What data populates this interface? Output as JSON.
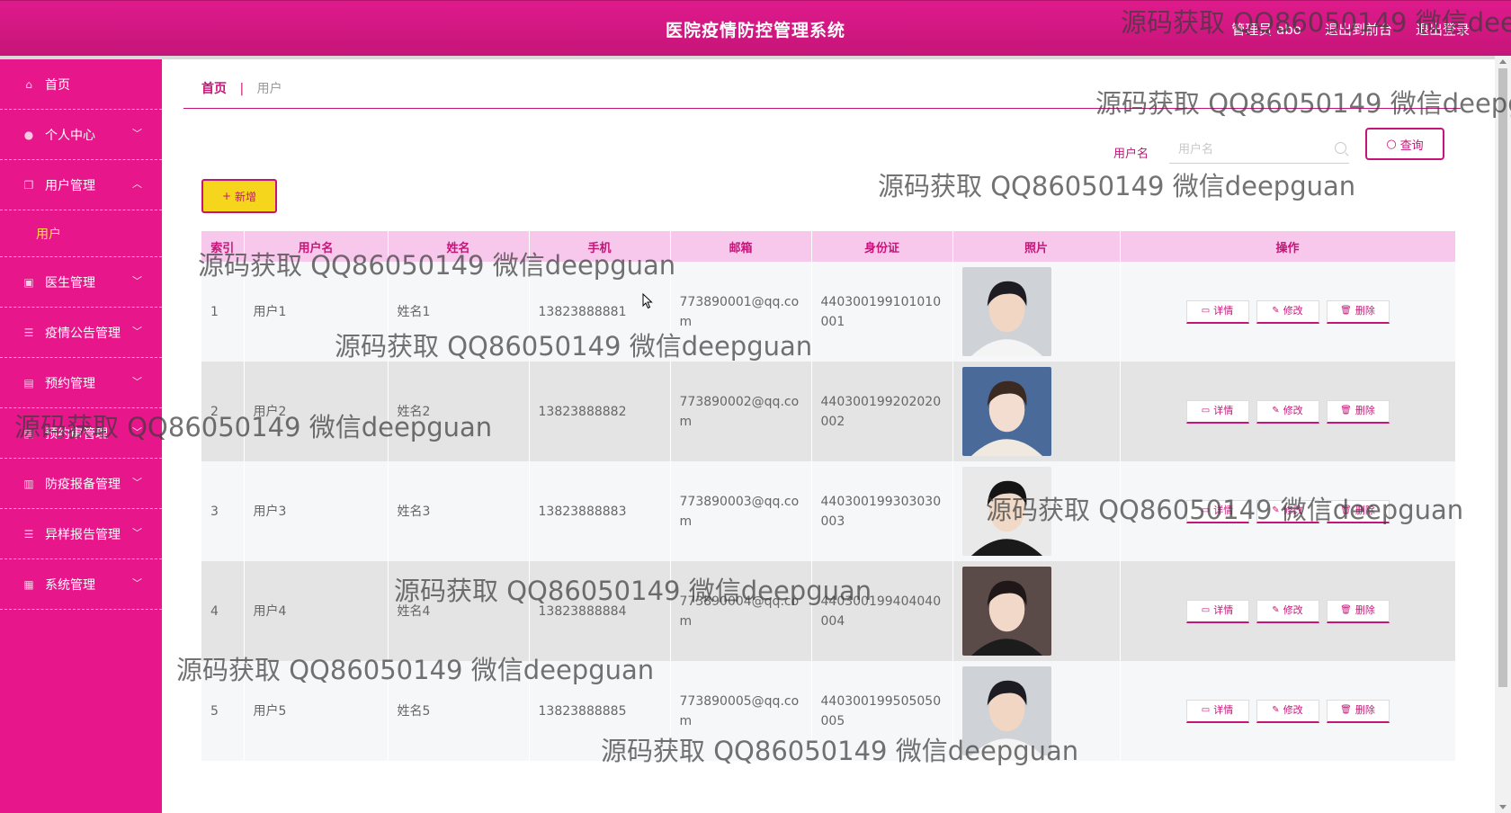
{
  "header": {
    "title": "医院疫情防控管理系统",
    "user": "管理员 abo",
    "to_front": "退出到前台",
    "logout": "退出登录"
  },
  "sidebar": {
    "items": [
      {
        "label": "首页",
        "icon": "home-icon",
        "chevron": ""
      },
      {
        "label": "个人中心",
        "icon": "user-icon",
        "chevron": "﹀"
      },
      {
        "label": "用户管理",
        "icon": "copy-icon",
        "chevron": "︿"
      },
      {
        "label": "医生管理",
        "icon": "chart-icon",
        "chevron": "﹀"
      },
      {
        "label": "疫情公告管理",
        "icon": "list-icon",
        "chevron": "﹀"
      },
      {
        "label": "预约管理",
        "icon": "clipboard-icon",
        "chevron": "﹀"
      },
      {
        "label": "预约审管理",
        "icon": "clipboard-icon",
        "chevron": "﹀"
      },
      {
        "label": "防疫报备管理",
        "icon": "report-icon",
        "chevron": "﹀"
      },
      {
        "label": "异样报告管理",
        "icon": "list-icon",
        "chevron": "﹀"
      },
      {
        "label": "系统管理",
        "icon": "settings-icon",
        "chevron": "﹀"
      }
    ],
    "sub_item": "用户"
  },
  "breadcrumb": {
    "home": "首页",
    "separator": "|",
    "current": "用户"
  },
  "search": {
    "label": "用户名",
    "placeholder": "用户名",
    "button": "查询"
  },
  "toolbar": {
    "add": "新增",
    "add_icon": "+"
  },
  "table": {
    "columns": [
      "索引",
      "用户名",
      "姓名",
      "手机",
      "邮箱",
      "身份证",
      "照片",
      "操作"
    ],
    "rows": [
      {
        "index": "1",
        "username": "用户1",
        "name": "姓名1",
        "phone": "13823888881",
        "email": "773890001@qq.com",
        "idcard": "440300199101010001",
        "photo": "male-portrait-1"
      },
      {
        "index": "2",
        "username": "用户2",
        "name": "姓名2",
        "phone": "13823888882",
        "email": "773890002@qq.com",
        "idcard": "440300199202020002",
        "photo": "female-portrait-1"
      },
      {
        "index": "3",
        "username": "用户3",
        "name": "姓名3",
        "phone": "13823888883",
        "email": "773890003@qq.com",
        "idcard": "440300199303030003",
        "photo": "male-portrait-2"
      },
      {
        "index": "4",
        "username": "用户4",
        "name": "姓名4",
        "phone": "13823888884",
        "email": "773890004@qq.com",
        "idcard": "440300199404040004",
        "photo": "female-portrait-2"
      },
      {
        "index": "5",
        "username": "用户5",
        "name": "姓名5",
        "phone": "13823888885",
        "email": "773890005@qq.com",
        "idcard": "440300199505050005",
        "photo": "male-portrait-1"
      }
    ],
    "actions": {
      "detail": "详情",
      "edit": "修改",
      "delete": "删除"
    }
  },
  "watermark": "源码获取 QQ86050149 微信deepguan",
  "colors": {
    "primary": "#c51578",
    "sidebar": "#e8168b",
    "accent": "#f6d61c",
    "header_row": "#f7c8ec"
  }
}
